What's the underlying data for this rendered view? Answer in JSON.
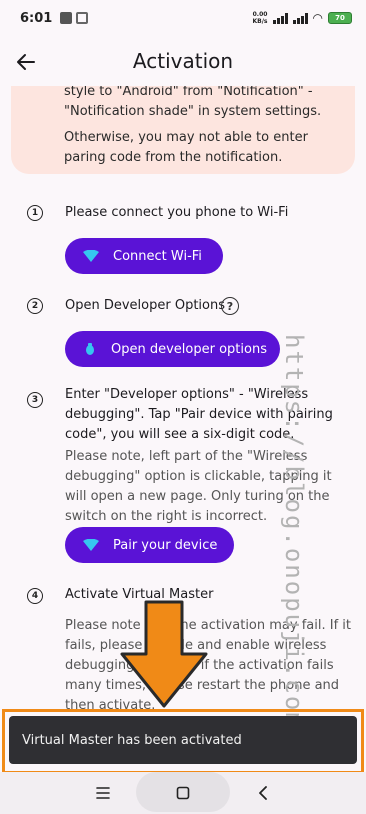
{
  "status_bar": {
    "time": "6:01",
    "net_speed_value": "0.00",
    "net_speed_unit": "KB/s",
    "battery_level": "70"
  },
  "header": {
    "title": "Activation"
  },
  "notice": {
    "line1": "style to \"Android\" from \"Notification\" - \"Notification shade\" in system settings.",
    "line2": "Otherwise, you may not able to enter paring code from the notification."
  },
  "steps": [
    {
      "number": "1",
      "text": "Please connect you phone to Wi-Fi",
      "button": "Connect Wi-Fi"
    },
    {
      "number": "2",
      "text": "Open Developer Options",
      "button": "Open developer options",
      "help": "?"
    },
    {
      "number": "3",
      "text": "Enter \"Developer options\" - \"Wireless debugging\". Tap \"Pair device with pairing code\", you will see a six-digit code.",
      "note": "Please note, left part of the \"Wireless debugging\" option is clickable, tapping it will open a new page. Only turing on the switch on the right is incorrect.",
      "button": "Pair your device"
    },
    {
      "number": "4",
      "text": "Activate Virtual Master",
      "note": "Please note that the activation may fail. If it fails, please disable and enable wireless debugging and pair; if the activation fails many times, please restart the phone and then activate."
    }
  ],
  "toast": {
    "message": "Virtual Master has been activated"
  },
  "watermark": "https://blog.onopuji.com",
  "colors": {
    "accent": "#5a13d6",
    "notice_bg": "#fde5df",
    "highlight": "#f08a17",
    "toast_bg": "#2f2f33"
  }
}
